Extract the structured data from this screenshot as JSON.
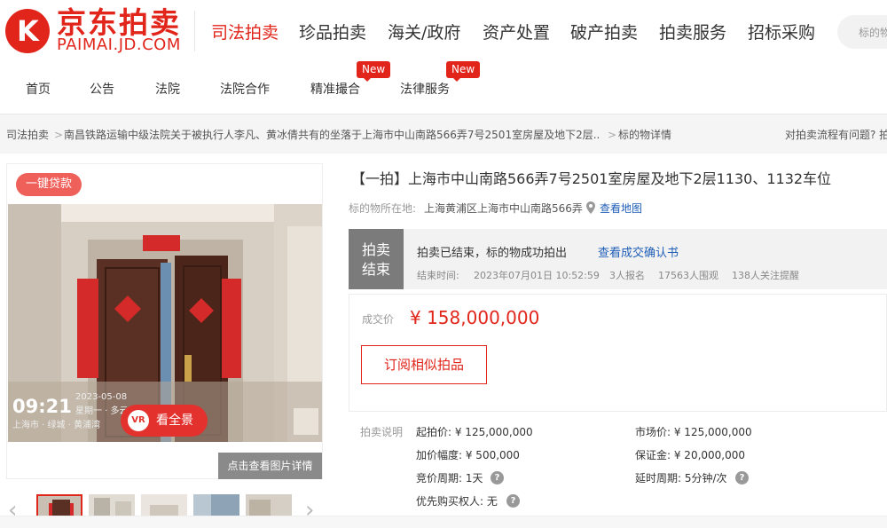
{
  "brand": {
    "logo_mark": "K",
    "name_cn": "京东拍卖",
    "name_en": "PAIMAI.JD.COM",
    "color": "#e1251b"
  },
  "top_nav": [
    "司法拍卖",
    "珍品拍卖",
    "海关/政府",
    "资产处置",
    "破产拍卖",
    "拍卖服务",
    "招标采购"
  ],
  "search": {
    "placeholder": "标的物名"
  },
  "sub_nav": [
    "首页",
    "公告",
    "法院",
    "法院合作",
    "精准撮合",
    "法律服务"
  ],
  "new_badge": "New",
  "breadcrumb": {
    "items": [
      "司法拍卖",
      "南昌铁路运输中级法院关于被执行人李凡、黄冰倩共有的坐落于上海市中山南路566弄7号2501室房屋及地下2层...",
      "标的物详情"
    ],
    "separator": ">",
    "help": "对拍卖流程有问题? 拍"
  },
  "gallery": {
    "loan_badge": "一键贷款",
    "watermark": {
      "time": "09:21",
      "date": "2023-05-08",
      "weather": "星期一 · 多云 1",
      "location": "上海市 · 绿城 · 黄浦湾"
    },
    "vr_icon": "VR",
    "vr_label": "看全景",
    "detail_button": "点击查看图片详情",
    "prev": "‹",
    "next": "›"
  },
  "item": {
    "title": "【一拍】上海市中山南路566弄7号2501室房屋及地下2层1130、1132车位",
    "location_label": "标的物所在地:",
    "location": "上海黄浦区上海市中山南路566弄",
    "map_link": "查看地图"
  },
  "status": {
    "box_line1": "拍卖",
    "box_line2": "结束",
    "message": "拍卖已结束，标的物成功拍出",
    "confirm_link": "查看成交确认书",
    "end_time_label": "结束时间:",
    "end_time": "2023年07月01日 10:52:59",
    "registrations": "3人报名",
    "viewers": "17563人围观",
    "followers": "138人关注提醒"
  },
  "deal": {
    "price_label": "成交价",
    "price": "¥ 158,000,000",
    "subscribe_button": "订阅相似拍品"
  },
  "details": {
    "label": "拍卖说明",
    "start_price": "起拍价: ¥ 125,000,000",
    "market_price": "市场价: ¥ 125,000,000",
    "increment": "加价幅度: ¥ 500,000",
    "deposit": "保证金: ¥ 20,000,000",
    "cycle": "竞价周期: 1天",
    "delay": "延时周期: 5分钟/次",
    "priority": "优先购买权人: 无",
    "help_glyph": "?"
  }
}
